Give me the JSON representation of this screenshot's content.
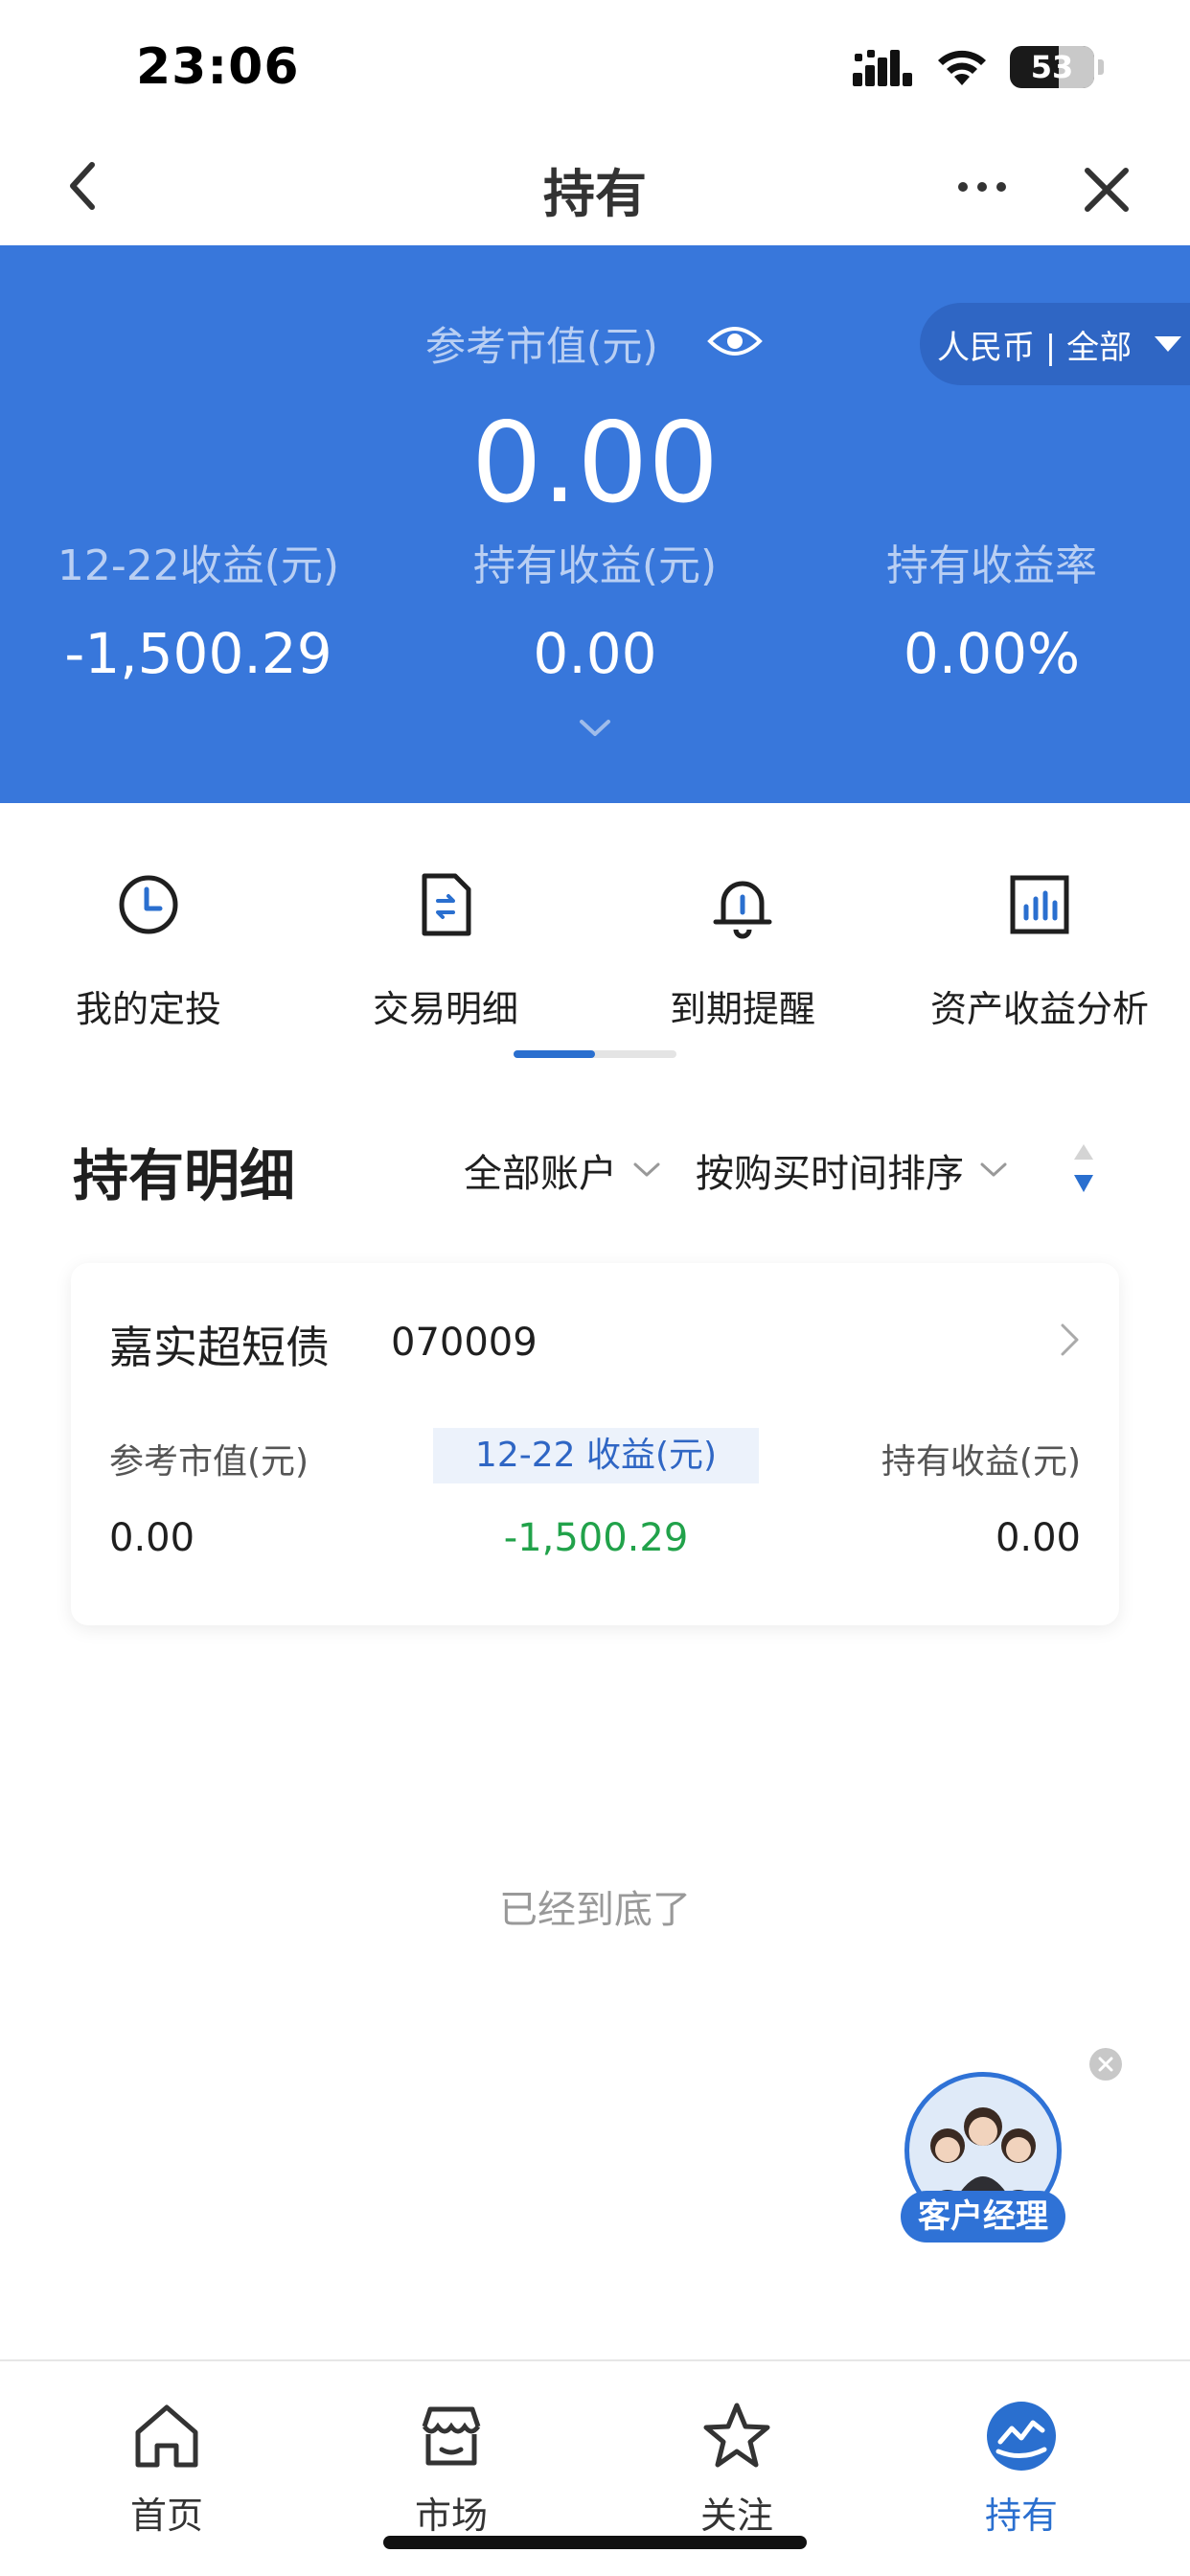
{
  "status_bar": {
    "time": "23:06",
    "battery": "53",
    "icons": [
      "cellular-signal-icon",
      "wifi-icon",
      "battery-icon"
    ]
  },
  "nav": {
    "title": "持有",
    "icons": [
      "back-icon",
      "more-icon",
      "close-icon"
    ]
  },
  "summary": {
    "market_value_label": "参考市值(元)",
    "market_value": "0.00",
    "currency_filter": "人民币 | 全部",
    "stats": [
      {
        "label": "12-22收益(元)",
        "value": "-1,500.29"
      },
      {
        "label": "持有收益(元)",
        "value": "0.00"
      },
      {
        "label": "持有收益率",
        "value": "0.00%"
      }
    ],
    "colors": {
      "background": "#3877db",
      "label": "#b9cff3"
    }
  },
  "actions": [
    {
      "label": "我的定投",
      "icon": "clock-icon"
    },
    {
      "label": "交易明细",
      "icon": "document-exchange-icon"
    },
    {
      "label": "到期提醒",
      "icon": "bell-icon"
    },
    {
      "label": "资产收益分析",
      "icon": "bar-chart-icon"
    }
  ],
  "actions_scroll_position": 0.5,
  "holdings": {
    "title": "持有明细",
    "account_filter": "全部账户",
    "sort_filter": "按购买时间排序",
    "items": [
      {
        "name": "嘉实超短债",
        "code": "070009",
        "labels": [
          "参考市值(元)",
          "12-22 收益(元)",
          "持有收益(元)"
        ],
        "values": [
          "0.00",
          "-1,500.29",
          "0.00"
        ]
      }
    ],
    "end_text": "已经到底了"
  },
  "customer_manager": {
    "label": "客户经理"
  },
  "tabs": [
    {
      "label": "首页",
      "icon": "home-icon",
      "active": false
    },
    {
      "label": "市场",
      "icon": "market-icon",
      "active": false
    },
    {
      "label": "关注",
      "icon": "star-icon",
      "active": false
    },
    {
      "label": "持有",
      "icon": "holdings-icon",
      "active": true
    }
  ],
  "colors": {
    "accent": "#2a6fcf",
    "gain_green": "#21a24a"
  }
}
